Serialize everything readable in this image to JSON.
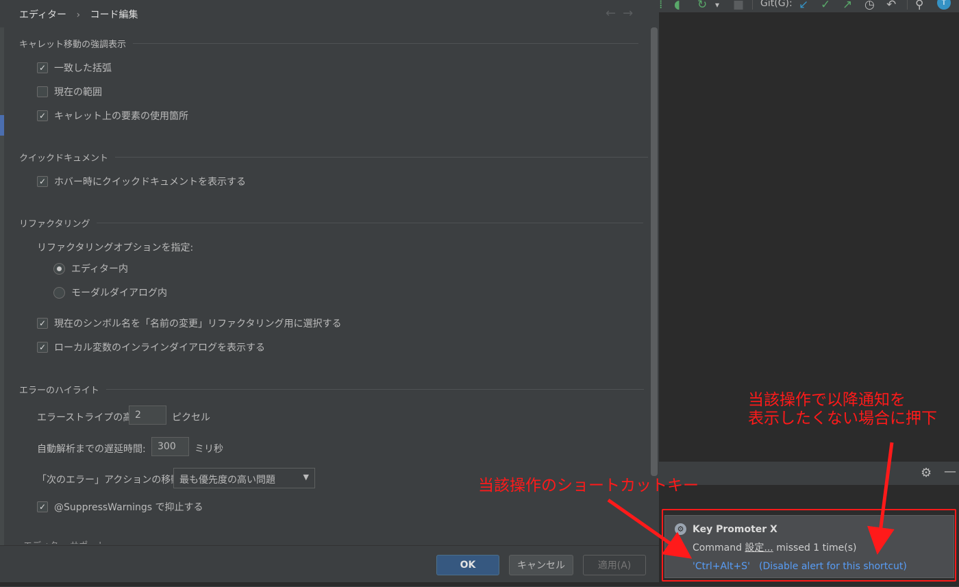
{
  "settings": {
    "breadcrumb": [
      "エディター",
      "コード編集"
    ],
    "nav": {
      "back": "←",
      "forward": "→"
    },
    "caret_section": {
      "title": "キャレット移動の強調表示",
      "items": [
        {
          "label": "一致した括弧",
          "checked": true
        },
        {
          "label": "現在の範囲",
          "checked": false
        },
        {
          "label": "キャレット上の要素の使用箇所",
          "checked": true
        }
      ]
    },
    "quickdoc_section": {
      "title": "クイックドキュメント",
      "items": [
        {
          "label": "ホバー時にクイックドキュメントを表示する",
          "checked": true
        }
      ]
    },
    "refactor_section": {
      "title": "リファクタリング",
      "option_label": "リファクタリングオプションを指定:",
      "radios": [
        {
          "label": "エディター内",
          "selected": true
        },
        {
          "label": "モーダルダイアログ内",
          "selected": false
        }
      ],
      "items": [
        {
          "label": "現在のシンボル名を「名前の変更」リファクタリング用に選択する",
          "checked": true
        },
        {
          "label": "ローカル変数のインラインダイアログを表示する",
          "checked": true
        }
      ]
    },
    "error_section": {
      "title": "エラーのハイライト",
      "stripe_label": "エラーストライプの高さ:",
      "stripe_value": "2",
      "stripe_unit": "ピクセル",
      "delay_label": "自動解析までの遅延時間:",
      "delay_value": "300",
      "delay_unit": "ミリ秒",
      "next_error_label": "「次のエラー」アクションの移動先:",
      "next_error_value": "最も優先度の高い問題",
      "suppress": {
        "label": "@SuppressWarnings で抑止する",
        "checked": true
      }
    },
    "cut_off_text": "エディター サポート",
    "buttons": {
      "ok": "OK",
      "cancel": "キャンセル",
      "apply": "適用(A)"
    }
  },
  "ide": {
    "toolbar": {
      "git_label": "Git(G):"
    },
    "notification": {
      "title": "Key Promoter X",
      "body_prefix": "Command ",
      "body_action": "設定...",
      "body_suffix": " missed 1 time(s)",
      "shortcut_link": "'Ctrl+Alt+S'",
      "disable_link": "(Disable alert for this shortcut)"
    }
  },
  "annotations": {
    "shortcut_note": "当該操作のショートカットキー",
    "disable_note_line1": "当該操作で以降通知を",
    "disable_note_line2": "表示したくない場合に押下",
    "color": "#ff1a1a"
  },
  "colors": {
    "background": "#3c3f41",
    "primary_button": "#365880",
    "link": "#589df6"
  }
}
